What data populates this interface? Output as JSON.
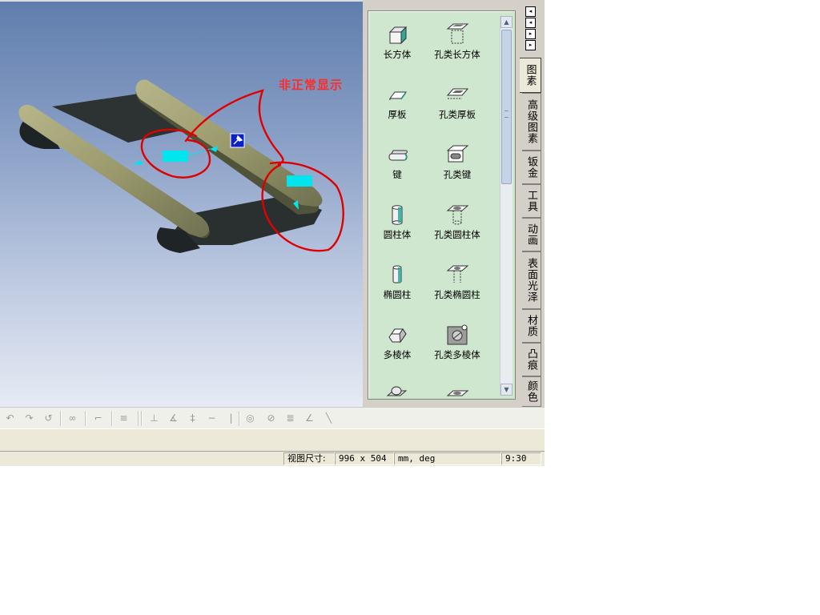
{
  "viewport": {
    "annotation": "非正常显示"
  },
  "catalog": {
    "items": [
      {
        "label": "长方体",
        "icon": "box-icon"
      },
      {
        "label": "孔类长方体",
        "icon": "hole-box-icon"
      },
      {
        "label": "厚板",
        "icon": "thick-plate-icon"
      },
      {
        "label": "孔类厚板",
        "icon": "hole-thick-plate-icon"
      },
      {
        "label": "键",
        "icon": "key-icon"
      },
      {
        "label": "孔类键",
        "icon": "hole-key-icon"
      },
      {
        "label": "圆柱体",
        "icon": "cylinder-icon"
      },
      {
        "label": "孔类圆柱体",
        "icon": "hole-cylinder-icon"
      },
      {
        "label": "椭圆柱",
        "icon": "elliptic-cylinder-icon"
      },
      {
        "label": "孔类椭圆柱",
        "icon": "hole-elliptic-cylinder-icon"
      },
      {
        "label": "多棱体",
        "icon": "prism-icon"
      },
      {
        "label": "孔类多棱体",
        "icon": "hole-prism-icon"
      }
    ]
  },
  "tabs": [
    "图素",
    "高级图素",
    "钣金",
    "工具",
    "动画",
    "表面光泽",
    "材质",
    "凸痕",
    "颜色"
  ],
  "statusbar": {
    "label": "视图尺寸:",
    "size": "996 x  504",
    "units": "mm, deg",
    "time": "9:30"
  },
  "colors": {
    "annotation": "#ff2b2b",
    "catalog_bg": "#cfe6cf",
    "part_top": "#8f8f62",
    "part_dark": "#2b3030",
    "highlight": "#00e5ee"
  }
}
